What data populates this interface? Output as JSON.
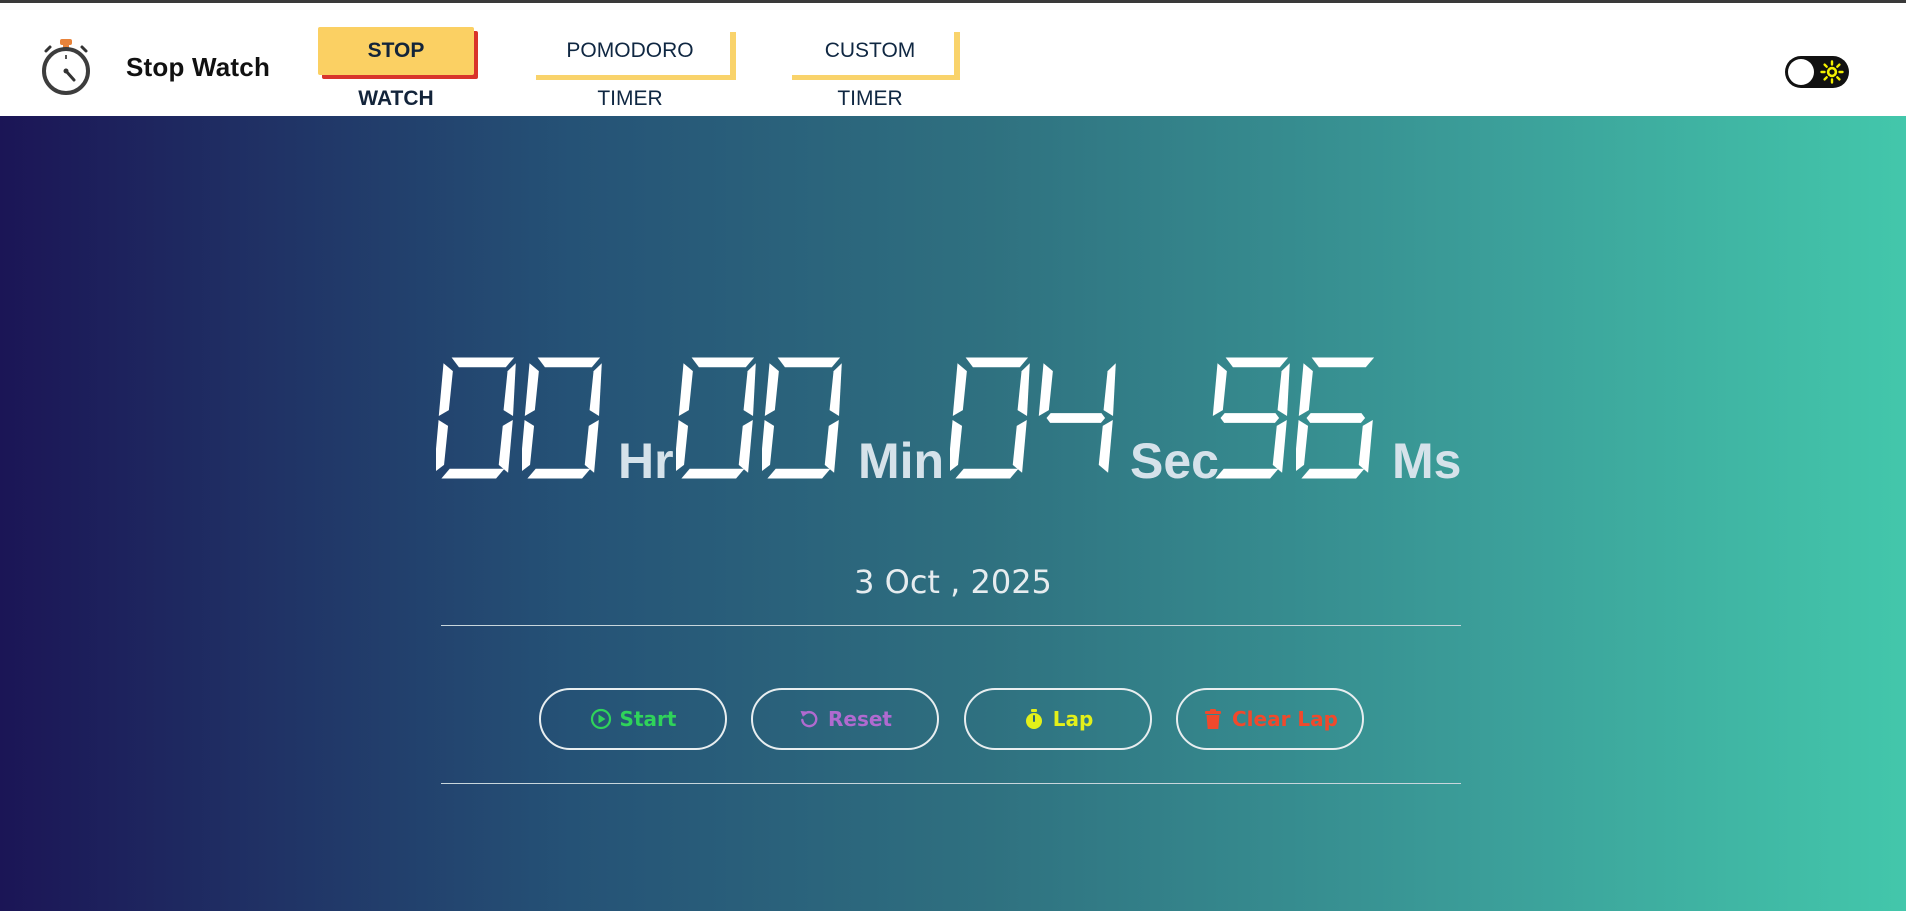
{
  "brand": {
    "title": "Stop Watch",
    "icon": "stopwatch-icon"
  },
  "nav": {
    "items": [
      {
        "label": "STOP WATCH",
        "active": true
      },
      {
        "label": "POMODORO TIMER",
        "active": false
      },
      {
        "label": "CUSTOM TIMER",
        "active": false
      }
    ]
  },
  "theme_toggle": {
    "state": "off",
    "icon": "sun-icon"
  },
  "timer": {
    "hours": "00",
    "hours_unit": "Hr",
    "minutes": "00",
    "minutes_unit": "Min",
    "seconds": "04",
    "seconds_unit": "Sec",
    "ms": "96",
    "ms_unit": "Ms"
  },
  "date": "3 Oct , 2025",
  "controls": {
    "start_label": "Start",
    "reset_label": "Reset",
    "lap_label": "Lap",
    "clear_label": "Clear Lap"
  },
  "colors": {
    "accent_nav": "#fbd063",
    "nav_active_shadow": "#d9342b",
    "start": "#2fd35a",
    "reset": "#b06ad0",
    "lap": "#e3f01a",
    "clear": "#f0492c",
    "gradient_start": "#1b1556",
    "gradient_end": "#43c7ab"
  }
}
